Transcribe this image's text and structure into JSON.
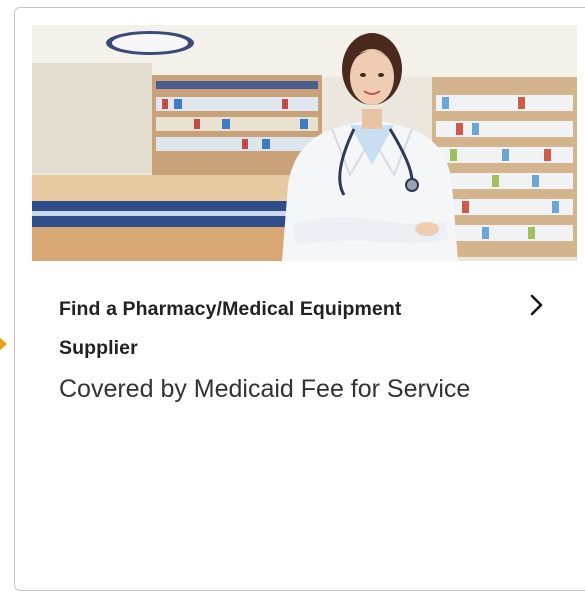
{
  "card": {
    "title": "Find a Pharmacy/Medical Equipment Supplier",
    "subtitle": "Covered by Medicaid Fee for Service",
    "image_subject": "pharmacist-in-pharmacy",
    "chevron_icon": "chevron-right-icon"
  },
  "colors": {
    "title_text": "#222222",
    "subtitle_text": "#333333",
    "card_border": "#c7c7c7",
    "focus_indicator": "#e2a412"
  }
}
